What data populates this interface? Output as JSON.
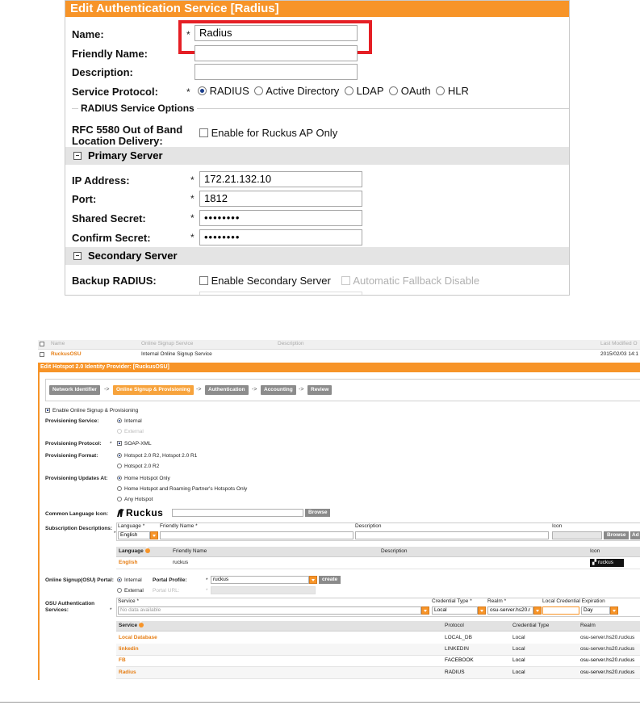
{
  "panel1": {
    "title": "Edit Authentication Service [Radius]",
    "name_label": "Name:",
    "name_value": "Radius",
    "friendly_label": "Friendly Name:",
    "description_label": "Description:",
    "protocol_label": "Service Protocol:",
    "protocols": [
      "RADIUS",
      "Active Directory",
      "LDAP",
      "OAuth",
      "HLR"
    ],
    "protocol_selected": "RADIUS",
    "options_title": "RADIUS Service Options",
    "rfc_label_1": "RFC 5580 Out of Band",
    "rfc_label_2": "Location Delivery:",
    "rfc_checkbox": "Enable for Ruckus AP Only",
    "primary_title": "Primary Server",
    "ip_label": "IP Address:",
    "ip_value": "172.21.132.10",
    "port_label": "Port:",
    "port_value": "1812",
    "secret_label": "Shared Secret:",
    "secret_value": "••••••••",
    "confirm_label": "Confirm Secret:",
    "confirm_value": "••••••••",
    "secondary_title": "Secondary Server",
    "backup_label": "Backup RADIUS:",
    "backup_checkbox": "Enable Secondary Server",
    "fallback_checkbox": "Automatic Fallback Disable",
    "required_mark": "*"
  },
  "panel2": {
    "list_header": {
      "name": "Name",
      "service": "Online Signup Service",
      "description": "Description",
      "last_modified": "Last Modified O"
    },
    "list_row": {
      "name": "RuckusOSU",
      "service": "Internal Online Signup Service",
      "last_modified": "2015/02/03 14:1"
    },
    "title": "Edit Hotspot 2.0 Identity Provider: [RuckusOSU]",
    "wizard": [
      "Network Identifier",
      "Online Signup & Provisioning",
      "Authentication",
      "Accounting",
      "Review"
    ],
    "wizard_arrow": "->",
    "enable_osu": "Enable Online Signup & Provisioning",
    "prov_service_label": "Provisioning Service:",
    "prov_service_options": [
      "Internal",
      "External"
    ],
    "prov_protocol_label": "Provisioning Protocol:",
    "prov_protocol_value": "SOAP-XML",
    "prov_format_label": "Provisioning Format:",
    "prov_format_options": [
      "Hotspot 2.0 R2, Hotspot 2.0 R1",
      "Hotspot 2.0 R2"
    ],
    "prov_updates_label": "Provisioning Updates At:",
    "prov_updates_options": [
      "Home Hotspot Only",
      "Home Hotspot and Roaming Partner's Hotspots Only",
      "Any Hotspot"
    ],
    "icon_label": "Common Language Icon:",
    "logo_text": "Ruckus",
    "browse": "Browse",
    "sub_desc_label": "Subscription Descriptions:",
    "sub_cols": {
      "language": "Language *",
      "friendly": "Friendly Name *",
      "description": "Description",
      "icon": "Icon"
    },
    "language_value": "English",
    "add_short": "Ad",
    "sub_table_headers": [
      "Language",
      "Friendly Name",
      "Description",
      "Icon"
    ],
    "sub_table_row": {
      "language": "English",
      "friendly": "ruckus",
      "icon_text": "ruckus"
    },
    "portal_label": "Online Signup(OSU) Portal:",
    "portal_options": [
      "Internal",
      "External"
    ],
    "portal_profile_label": "Portal Profile:",
    "portal_profile_value": "ruckus",
    "create": "create",
    "portal_url_label": "Portal URL:",
    "osu_auth_label_1": "OSU Authentication",
    "osu_auth_label_2": "Services:",
    "auth_cols": {
      "service": "Service *",
      "cred_type": "Credential Type *",
      "realm": "Realm *",
      "local_exp": "Local Credential Expiration"
    },
    "service_placeholder": "No data available",
    "cred_type_value": "Local",
    "realm_value": "osu-server.hs20.r",
    "exp_unit": "Day",
    "auth_table_headers": [
      "Service",
      "Protocol",
      "Credential Type",
      "Realm"
    ],
    "auth_rows": [
      {
        "service": "Local Database",
        "protocol": "LOCAL_DB",
        "cred": "Local",
        "realm": "osu-server.hs20.ruckus"
      },
      {
        "service": "linkedin",
        "protocol": "LINKEDIN",
        "cred": "Local",
        "realm": "osu-server.hs20.ruckus"
      },
      {
        "service": "FB",
        "protocol": "FACEBOOK",
        "cred": "Local",
        "realm": "osu-server.hs20.ruckus"
      },
      {
        "service": "Radius",
        "protocol": "RADIUS",
        "cred": "Local",
        "realm": "osu-server.hs20.ruckus"
      }
    ]
  },
  "colors": {
    "accent": "#f79428",
    "highlight": "#e51f25"
  }
}
